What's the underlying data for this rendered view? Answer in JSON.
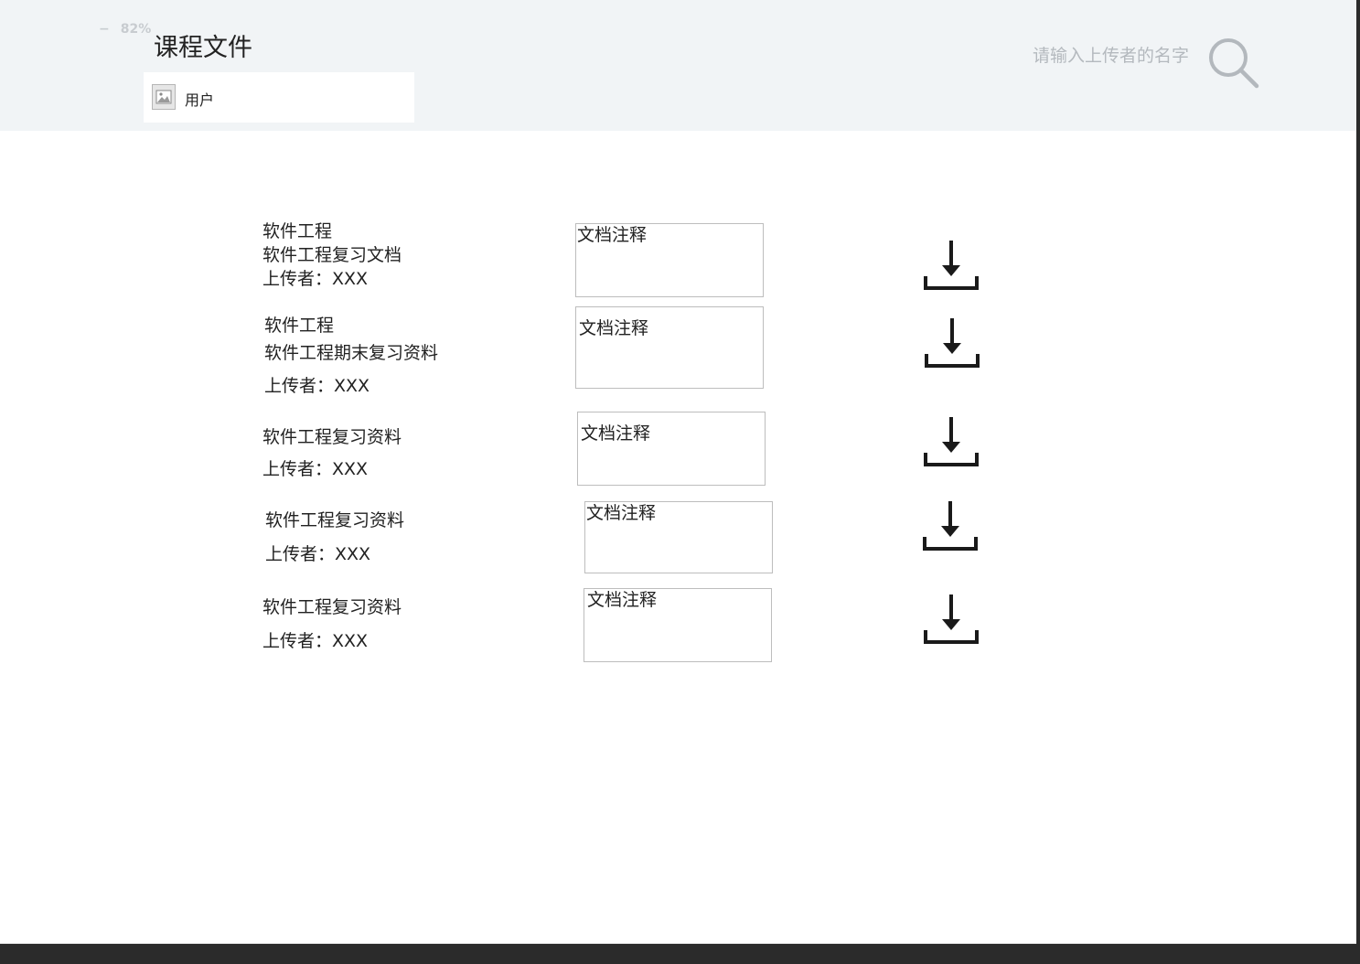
{
  "header": {
    "zoom_minus": "−",
    "zoom_level": "82%",
    "title": "课程文件",
    "user_label": "用户",
    "search_placeholder": "请输入上传者的名字"
  },
  "files": [
    {
      "lines": [
        "软件工程",
        "软件工程复习文档",
        "上传者：XXX"
      ],
      "comment": "文档注释"
    },
    {
      "lines": [
        "软件工程",
        "软件工程期末复习资料",
        "上传者：XXX"
      ],
      "comment": "文档注释"
    },
    {
      "lines": [
        "软件工程复习资料",
        "上传者：XXX"
      ],
      "comment": "文档注释"
    },
    {
      "lines": [
        "软件工程复习资料",
        "上传者：XXX"
      ],
      "comment": "文档注释"
    },
    {
      "lines": [
        "软件工程复习资料",
        "上传者：XXX"
      ],
      "comment": "文档注释"
    }
  ],
  "icons": {
    "avatar": "image-placeholder-icon",
    "search": "magnifier-icon",
    "download": "download-icon"
  },
  "colors": {
    "header_bg": "#f1f4f6",
    "placeholder": "#b4b9be",
    "icon_dark": "#1a1a1a",
    "search_icon": "#b3b8bd"
  }
}
